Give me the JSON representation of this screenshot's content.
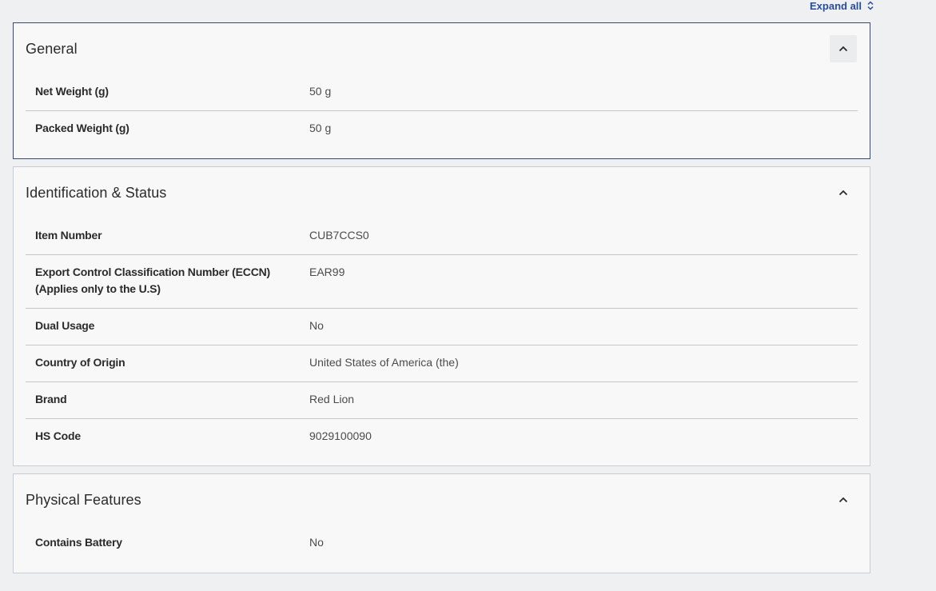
{
  "header": {
    "expand_all_label": "Expand all"
  },
  "icons": {
    "expand": "chevron-up-down-icon",
    "collapse": "chevron-up-icon"
  },
  "colors": {
    "link": "#2a4d9b",
    "panel_bg": "#f8f8f9",
    "page_bg": "#eff0f2"
  },
  "sections": [
    {
      "title": "General",
      "rows": [
        {
          "label": "Net Weight (g)",
          "value": "50 g"
        },
        {
          "label": "Packed Weight (g)",
          "value": "50 g"
        }
      ]
    },
    {
      "title": "Identification & Status",
      "rows": [
        {
          "label": "Item Number",
          "value": "CUB7CCS0"
        },
        {
          "label": "Export Control Classification Number (ECCN) (Applies only to the U.S)",
          "value": "EAR99"
        },
        {
          "label": "Dual Usage",
          "value": "No"
        },
        {
          "label": "Country of Origin",
          "value": "United States of America (the)"
        },
        {
          "label": "Brand",
          "value": "Red Lion"
        },
        {
          "label": "HS Code",
          "value": "9029100090"
        }
      ]
    },
    {
      "title": "Physical Features",
      "rows": [
        {
          "label": "Contains Battery",
          "value": "No"
        }
      ]
    }
  ]
}
